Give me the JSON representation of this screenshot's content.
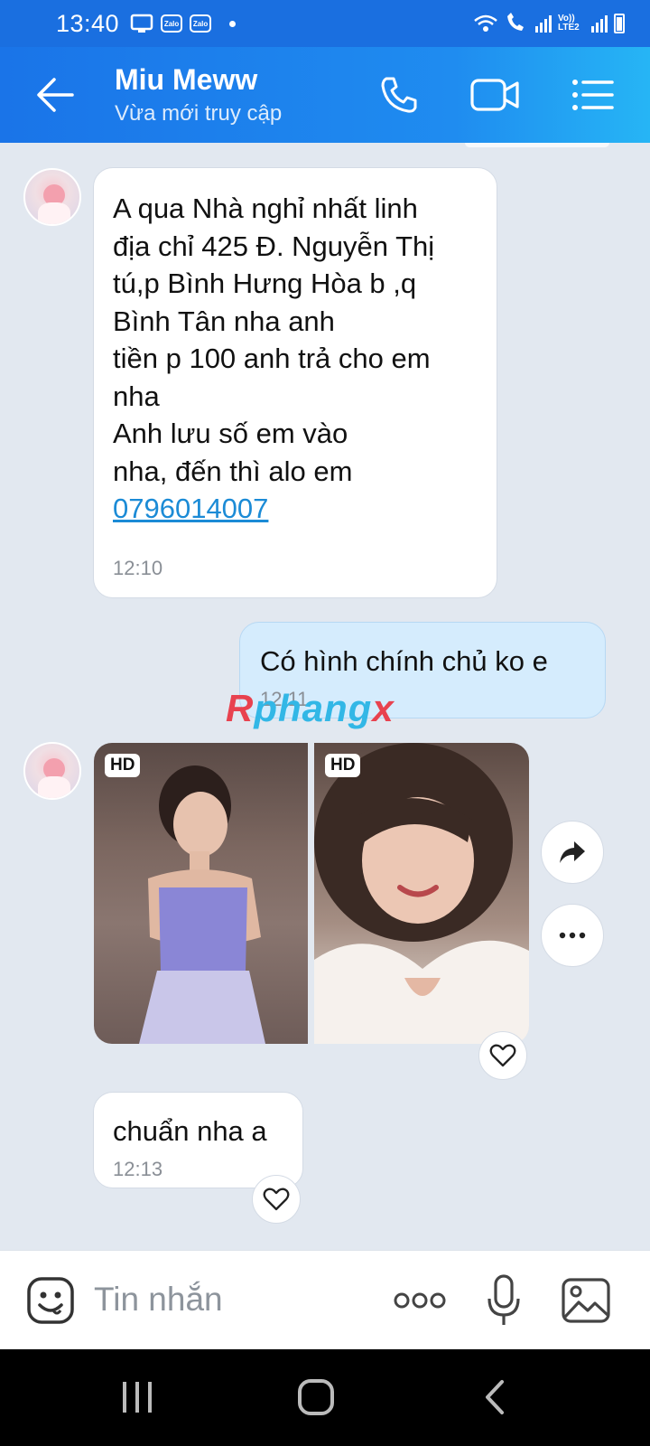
{
  "status_bar": {
    "time": "13:40",
    "left_icons": [
      "screen-icon",
      "zalo-app-icon",
      "zalo-app-icon",
      "notification-dot-icon"
    ],
    "zalo_label": "Zalo",
    "network_label": "Vo)) LTE2",
    "right_icons": [
      "wifi-icon",
      "wifi-calling-icon",
      "signal-icon",
      "signal-icon",
      "battery-icon"
    ]
  },
  "header": {
    "contact_name": "Miu Meww",
    "contact_status": "Vừa mới truy cập",
    "icons": [
      "back-arrow-icon",
      "phone-call-icon",
      "video-call-icon",
      "menu-list-icon"
    ]
  },
  "messages": [
    {
      "sender": "other",
      "text": "A qua Nhà nghỉ nhất linh\nđịa chỉ 425 Đ. Nguyễn Thị\ntú,p Bình Hưng Hòa b ,q\nBình Tân nha anh\ntiền p 100 anh trả cho em\nnha\nAnh lưu số em vào\nnha, đến thì alo em",
      "link": "0796014007",
      "time": "12:10"
    },
    {
      "sender": "me",
      "text": "Có hình chính chủ ko e",
      "time": "12:11"
    },
    {
      "sender": "other",
      "type": "photos",
      "photos": [
        {
          "badge": "HD",
          "description_icon": "photo-thumbnail"
        },
        {
          "badge": "HD",
          "description_icon": "photo-thumbnail"
        }
      ],
      "actions": [
        "forward-arrow-icon",
        "more-dots-icon",
        "heart-icon"
      ]
    },
    {
      "sender": "other",
      "text": "chuẩn nha a",
      "time": "12:13",
      "reaction_icon": "heart-icon"
    }
  ],
  "watermark": {
    "part1": "R",
    "part2": "phang",
    "part3": "x"
  },
  "input": {
    "placeholder": "Tin nhắn",
    "icons": [
      "sticker-emoji-icon",
      "more-options-icon",
      "microphone-icon",
      "image-gallery-icon"
    ]
  },
  "nav_bar": {
    "icons": [
      "recent-apps-icon",
      "home-icon",
      "back-icon"
    ]
  },
  "colors": {
    "header_start": "#1a74e8",
    "header_end": "#26b5f5",
    "chat_bg": "#e2e8f0",
    "my_bubble": "#d5ecfd",
    "link": "#1b8bd6"
  }
}
